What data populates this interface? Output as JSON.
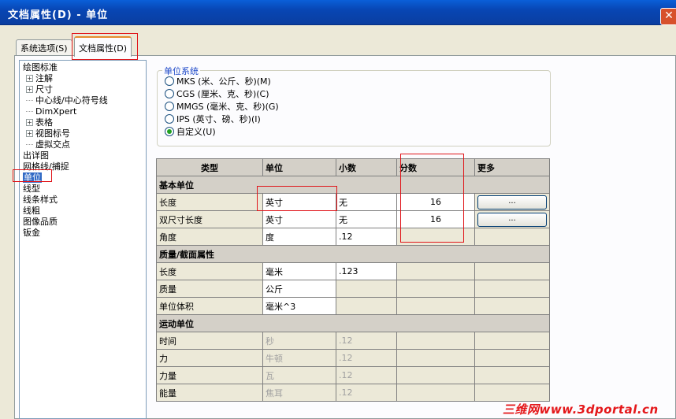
{
  "window": {
    "title": "文档属性(D) - 单位"
  },
  "tabs": [
    {
      "label": "系统选项(S)"
    },
    {
      "label": "文档属性(D)"
    }
  ],
  "tree": {
    "items": [
      {
        "label": "绘图标准",
        "level": 0,
        "expander": ""
      },
      {
        "label": "注解",
        "level": 1,
        "expander": "+"
      },
      {
        "label": "尺寸",
        "level": 1,
        "expander": "+"
      },
      {
        "label": "中心线/中心符号线",
        "level": 1,
        "expander": ""
      },
      {
        "label": "DimXpert",
        "level": 1,
        "expander": ""
      },
      {
        "label": "表格",
        "level": 1,
        "expander": "+"
      },
      {
        "label": "视图标号",
        "level": 1,
        "expander": "+"
      },
      {
        "label": "虚拟交点",
        "level": 1,
        "expander": ""
      },
      {
        "label": "出详图",
        "level": 0,
        "expander": ""
      },
      {
        "label": "网格线/捕捉",
        "level": 0,
        "expander": ""
      },
      {
        "label": "单位",
        "level": 0,
        "expander": "",
        "selected": true
      },
      {
        "label": "线型",
        "level": 0,
        "expander": ""
      },
      {
        "label": "线条样式",
        "level": 0,
        "expander": ""
      },
      {
        "label": "线粗",
        "level": 0,
        "expander": ""
      },
      {
        "label": "图像品质",
        "level": 0,
        "expander": ""
      },
      {
        "label": "钣金",
        "level": 0,
        "expander": ""
      }
    ]
  },
  "unit_system": {
    "legend": "单位系统",
    "options": [
      {
        "label": "MKS (米、公斤、秒)(M)",
        "checked": false
      },
      {
        "label": "CGS (厘米、克、秒)(C)",
        "checked": false
      },
      {
        "label": "MMGS (毫米、克、秒)(G)",
        "checked": false
      },
      {
        "label": "IPS (英寸、磅、秒)(I)",
        "checked": false
      },
      {
        "label": "自定义(U)",
        "checked": true
      }
    ]
  },
  "units_table": {
    "headers": {
      "type": "类型",
      "unit": "单位",
      "decimals": "小数",
      "fractions": "分数",
      "more": "更多"
    },
    "more_button_label": "...",
    "sections": [
      {
        "title": "基本单位",
        "rows": [
          {
            "type": "长度",
            "unit": "英寸",
            "decimals": "无",
            "fractions": "16",
            "more": true,
            "state": "editable"
          },
          {
            "type": "双尺寸长度",
            "unit": "英寸",
            "decimals": "无",
            "fractions": "16",
            "more": true,
            "state": "editable"
          },
          {
            "type": "角度",
            "unit": "度",
            "decimals": ".12",
            "fractions": "",
            "more": false,
            "state": "editable"
          }
        ]
      },
      {
        "title": "质量/截面属性",
        "rows": [
          {
            "type": "长度",
            "unit": "毫米",
            "decimals": ".123",
            "fractions": "",
            "more": false,
            "state": "editable"
          },
          {
            "type": "质量",
            "unit": "公斤",
            "decimals": "",
            "fractions": "",
            "more": false,
            "state": "editable"
          },
          {
            "type": "单位体积",
            "unit": "毫米^3",
            "decimals": "",
            "fractions": "",
            "more": false,
            "state": "editable"
          }
        ]
      },
      {
        "title": "运动单位",
        "rows": [
          {
            "type": "时间",
            "unit": "秒",
            "decimals": ".12",
            "fractions": "",
            "more": false,
            "state": "disabled"
          },
          {
            "type": "力",
            "unit": "牛顿",
            "decimals": ".12",
            "fractions": "",
            "more": false,
            "state": "disabled"
          },
          {
            "type": "力量",
            "unit": "瓦",
            "decimals": ".12",
            "fractions": "",
            "more": false,
            "state": "disabled"
          },
          {
            "type": "能量",
            "unit": "焦耳",
            "decimals": ".12",
            "fractions": "",
            "more": false,
            "state": "disabled"
          }
        ]
      }
    ]
  },
  "watermark": "三维网www.3dportal.cn",
  "colors": {
    "titlebar": "#0846b4",
    "highlight": "#e0151a",
    "selection": "#316ac5",
    "watermark": "#e4171a"
  }
}
